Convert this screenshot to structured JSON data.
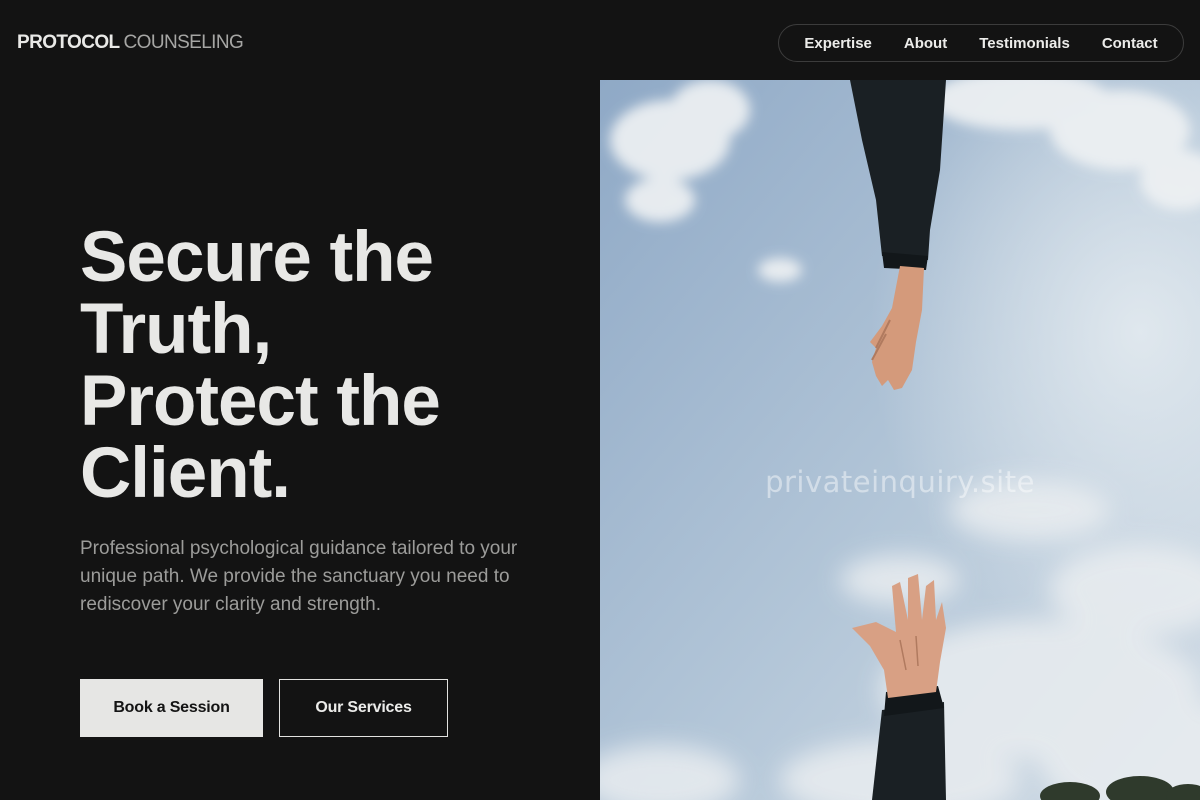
{
  "brand": {
    "name_strong": "PROTOCOL",
    "name_light": "COUNSELING"
  },
  "nav": {
    "items": [
      {
        "label": "Expertise"
      },
      {
        "label": "About"
      },
      {
        "label": "Testimonials"
      },
      {
        "label": "Contact"
      }
    ]
  },
  "hero": {
    "title_lines": [
      "Secure the",
      "Truth,",
      "Protect the",
      "Client."
    ],
    "subtitle": "Professional psychological guidance tailored to your unique path. We provide the sanctuary you need to rediscover your clarity and strength.",
    "primary_button": "Book a Session",
    "secondary_button": "Our Services"
  },
  "image": {
    "watermark": "privateinquiry.site"
  },
  "colors": {
    "background": "#131313",
    "text": "#e8e8e6",
    "muted": "#9c9c9a",
    "button_fill": "#e6e6e4",
    "sky": "#a9bed4"
  }
}
